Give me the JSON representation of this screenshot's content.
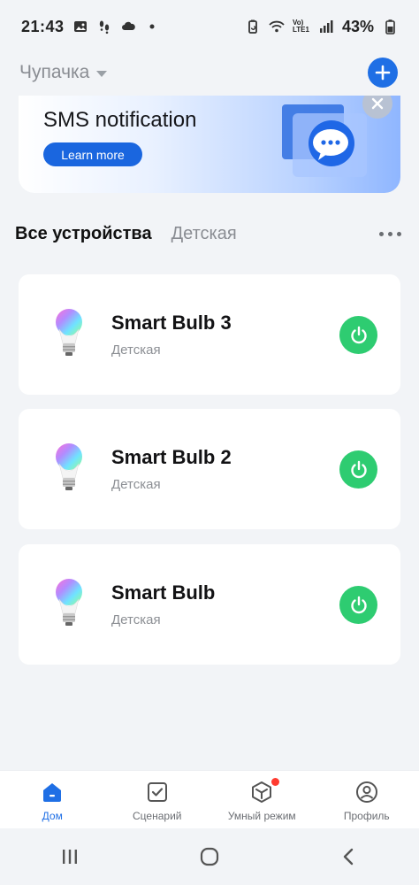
{
  "status_bar": {
    "time": "21:43",
    "battery": "43%",
    "signal_label": "Vo) LTE1"
  },
  "header": {
    "home_name": "Чупачка"
  },
  "banner": {
    "title": "SMS notification",
    "button": "Learn more"
  },
  "tabs": [
    {
      "label": "Все устройства",
      "active": true
    },
    {
      "label": "Детская",
      "active": false
    }
  ],
  "devices": [
    {
      "name": "Smart Bulb 3",
      "room": "Детская",
      "on": true
    },
    {
      "name": "Smart Bulb 2",
      "room": "Детская",
      "on": true
    },
    {
      "name": "Smart Bulb",
      "room": "Детская",
      "on": true
    }
  ],
  "bottom_nav": [
    {
      "label": "Дом",
      "icon": "home-icon",
      "active": true
    },
    {
      "label": "Сценарий",
      "icon": "checkbox-icon",
      "active": false
    },
    {
      "label": "Умный режим",
      "icon": "cube-icon",
      "active": false,
      "badge": true
    },
    {
      "label": "Профиль",
      "icon": "profile-icon",
      "active": false
    }
  ],
  "colors": {
    "accent": "#1f6fe5",
    "power_on": "#2ecc71",
    "badge": "#ff3b30"
  }
}
